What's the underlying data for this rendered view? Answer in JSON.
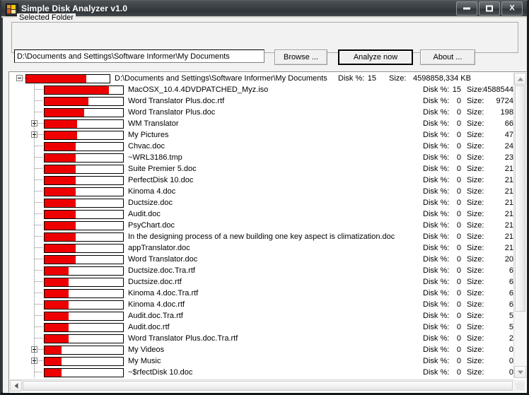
{
  "window": {
    "title": "Simple Disk Analyzer v1.0",
    "icon": "disk-analyzer-icon",
    "buttons": {
      "minimize": "minimize-icon",
      "maximize": "maximize-icon",
      "close": "X"
    }
  },
  "form": {
    "group_label": "Selected Folder",
    "path_value": "D:\\Documents and Settings\\Software Informer\\My Documents",
    "path_placeholder": "",
    "browse_label": "Browse ...",
    "analyze_label": "Analyze now",
    "about_label": "About ..."
  },
  "columns": {
    "disk_pct_label": "Disk %:",
    "size_label": "Size:"
  },
  "tree": {
    "rows": [
      {
        "indent": 0,
        "twisty": "minus",
        "fill": 72,
        "name": "D:\\Documents and Settings\\Software Informer\\My Documents",
        "disk_pct": "15",
        "size": "4598858,334 KB"
      },
      {
        "indent": 1,
        "twisty": "none",
        "fill": 82,
        "name": "MacOSX_10.4.4DVDPATCHED_Myz.iso",
        "disk_pct": "15",
        "size": "4588544"
      },
      {
        "indent": 1,
        "twisty": "none",
        "fill": 56,
        "name": "Word Translator Plus.doc.rtf",
        "disk_pct": "0",
        "size": "9724"
      },
      {
        "indent": 1,
        "twisty": "none",
        "fill": 50,
        "name": "Word Translator Plus.doc",
        "disk_pct": "0",
        "size": "198"
      },
      {
        "indent": 1,
        "twisty": "plus",
        "fill": 41,
        "name": "WM Translator",
        "disk_pct": "0",
        "size": "66"
      },
      {
        "indent": 1,
        "twisty": "plus",
        "fill": 41,
        "name": "My Pictures",
        "disk_pct": "0",
        "size": "47"
      },
      {
        "indent": 1,
        "twisty": "none",
        "fill": 40,
        "name": "Chvac.doc",
        "disk_pct": "0",
        "size": "24"
      },
      {
        "indent": 1,
        "twisty": "none",
        "fill": 40,
        "name": "~WRL3186.tmp",
        "disk_pct": "0",
        "size": "23"
      },
      {
        "indent": 1,
        "twisty": "none",
        "fill": 40,
        "name": "Suite Premier 5.doc",
        "disk_pct": "0",
        "size": "21"
      },
      {
        "indent": 1,
        "twisty": "none",
        "fill": 40,
        "name": "PerfectDisk 10.doc",
        "disk_pct": "0",
        "size": "21"
      },
      {
        "indent": 1,
        "twisty": "none",
        "fill": 40,
        "name": "Kinoma 4.doc",
        "disk_pct": "0",
        "size": "21"
      },
      {
        "indent": 1,
        "twisty": "none",
        "fill": 40,
        "name": "Ductsize.doc",
        "disk_pct": "0",
        "size": "21"
      },
      {
        "indent": 1,
        "twisty": "none",
        "fill": 40,
        "name": "Audit.doc",
        "disk_pct": "0",
        "size": "21"
      },
      {
        "indent": 1,
        "twisty": "none",
        "fill": 40,
        "name": "PsyChart.doc",
        "disk_pct": "0",
        "size": "21"
      },
      {
        "indent": 1,
        "twisty": "none",
        "fill": 40,
        "name": "In the designing process of a new building one key aspect is climatization.doc",
        "disk_pct": "0",
        "size": "21"
      },
      {
        "indent": 1,
        "twisty": "none",
        "fill": 40,
        "name": "appTranslator.doc",
        "disk_pct": "0",
        "size": "21"
      },
      {
        "indent": 1,
        "twisty": "none",
        "fill": 40,
        "name": "Word Translator.doc",
        "disk_pct": "0",
        "size": "20"
      },
      {
        "indent": 1,
        "twisty": "none",
        "fill": 31,
        "name": "Ductsize.doc.Tra.rtf",
        "disk_pct": "0",
        "size": "6"
      },
      {
        "indent": 1,
        "twisty": "none",
        "fill": 31,
        "name": "Ductsize.doc.rtf",
        "disk_pct": "0",
        "size": "6"
      },
      {
        "indent": 1,
        "twisty": "none",
        "fill": 31,
        "name": "Kinoma 4.doc.Tra.rtf",
        "disk_pct": "0",
        "size": "6"
      },
      {
        "indent": 1,
        "twisty": "none",
        "fill": 31,
        "name": "Kinoma 4.doc.rtf",
        "disk_pct": "0",
        "size": "6"
      },
      {
        "indent": 1,
        "twisty": "none",
        "fill": 31,
        "name": "Audit.doc.Tra.rtf",
        "disk_pct": "0",
        "size": "5"
      },
      {
        "indent": 1,
        "twisty": "none",
        "fill": 31,
        "name": "Audit.doc.rtf",
        "disk_pct": "0",
        "size": "5"
      },
      {
        "indent": 1,
        "twisty": "none",
        "fill": 31,
        "name": "Word Translator Plus.doc.Tra.rtf",
        "disk_pct": "0",
        "size": "2"
      },
      {
        "indent": 1,
        "twisty": "plus",
        "fill": 22,
        "name": "My Videos",
        "disk_pct": "0",
        "size": "0"
      },
      {
        "indent": 1,
        "twisty": "plus",
        "fill": 22,
        "name": "My Music",
        "disk_pct": "0",
        "size": "0"
      },
      {
        "indent": 1,
        "twisty": "none",
        "fill": 22,
        "name": "~$rfectDisk 10.doc",
        "disk_pct": "0",
        "size": "0"
      }
    ]
  },
  "scrollbars": {
    "vertical": {
      "up": "scroll-up-arrow",
      "down": "scroll-down-arrow"
    },
    "horizontal": {
      "left": "scroll-left-arrow"
    }
  },
  "colors": {
    "bar_fill": "#ee0000",
    "titlebar": "#3a3f42",
    "client_bg": "#f2f2f2"
  }
}
